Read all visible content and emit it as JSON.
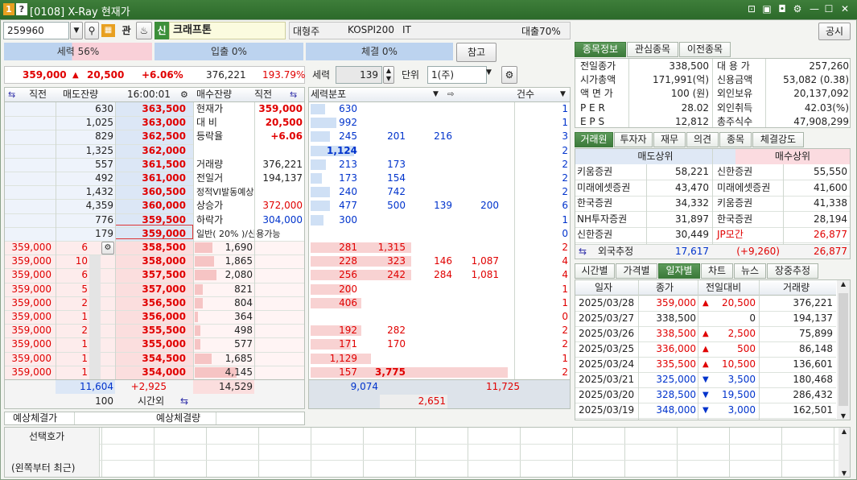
{
  "window": {
    "badge1": "1",
    "badge2": "?",
    "title": "[0108] X-Ray 현재가"
  },
  "colors": {
    "ask_bg": "#eef3fb",
    "bid_bg": "#fdecec",
    "green": "#3b7a39",
    "up": "#e00000",
    "down": "#0033cc"
  },
  "top": {
    "code": "259960",
    "gwan": "관",
    "shin": "신",
    "name": "크래프톤",
    "category": "대형주",
    "index": "KOSPI200",
    "sector": "IT",
    "loan": "대출70%",
    "notice": "공시"
  },
  "strength": {
    "seryuk": "세력 56%",
    "ipchul": "입출 0%",
    "chegyeol": "체결 0%",
    "ref": "참고"
  },
  "price": {
    "cur": "359,000",
    "arrow": "▲",
    "diff": "20,500",
    "rate": "+6.06%",
    "vol": "376,221",
    "pct": "193.79%"
  },
  "ctrl": {
    "seryuk_label": "세력",
    "seryuk_val": "139",
    "unit_label": "단위",
    "unit_val": "1(주)"
  },
  "book_head": {
    "prev": "직전",
    "ask_qty": "매도잔량",
    "time": "16:00:01",
    "bid_qty": "매수잔량",
    "prev2": "직전",
    "dist": "세력분포",
    "count": "건수"
  },
  "asks": [
    {
      "q": "630",
      "p": "363,500",
      "l": "현재가",
      "v": "359,000",
      "d": [
        "630"
      ]
    },
    {
      "q": "1,025",
      "p": "363,000",
      "l": "대  비",
      "v": "20,500",
      "d": [
        "992"
      ]
    },
    {
      "q": "829",
      "p": "362,500",
      "l": "등락율",
      "v": "+6.06",
      "d": [
        "245",
        "201",
        "216"
      ]
    },
    {
      "q": "1,325",
      "p": "362,000",
      "l": "",
      "v": "",
      "d": [
        "1,124"
      ]
    },
    {
      "q": "557",
      "p": "361,500",
      "l": "거래량",
      "v": "376,221",
      "d": [
        "213",
        "173"
      ]
    },
    {
      "q": "492",
      "p": "361,000",
      "l": "전일거",
      "v": "194,137",
      "d": [
        "173",
        "154"
      ]
    },
    {
      "q": "1,432",
      "p": "360,500",
      "l": "정적VI발동예상",
      "v": "",
      "d": [
        "240",
        "742"
      ]
    },
    {
      "q": "4,359",
      "p": "360,000",
      "l": "상승가",
      "v": "372,000",
      "d": [
        "477",
        "500",
        "139",
        "200"
      ]
    },
    {
      "q": "776",
      "p": "359,500",
      "l": "하락가",
      "v": "304,000",
      "d": [
        "300"
      ]
    },
    {
      "q": "179",
      "p": "359,000",
      "l": "일반( 20% )/신용가능",
      "v": "",
      "d": []
    }
  ],
  "ask_counts": [
    "1",
    "1",
    "3",
    "2",
    "2",
    "2",
    "2",
    "6",
    "1",
    "0"
  ],
  "bids": [
    {
      "pp": "359,000",
      "pc": "6",
      "p": "358,500",
      "q": "1,690",
      "d": [
        "281",
        "1,315"
      ]
    },
    {
      "pp": "359,000",
      "pc": "10",
      "p": "358,000",
      "q": "1,865",
      "d": [
        "228",
        "323",
        "146",
        "1,087"
      ]
    },
    {
      "pp": "359,000",
      "pc": "6",
      "p": "357,500",
      "q": "2,080",
      "d": [
        "256",
        "242",
        "284",
        "1,081"
      ]
    },
    {
      "pp": "359,000",
      "pc": "5",
      "p": "357,000",
      "q": "821",
      "d": [
        "200"
      ]
    },
    {
      "pp": "359,000",
      "pc": "2",
      "p": "356,500",
      "q": "804",
      "d": [
        "406"
      ]
    },
    {
      "pp": "359,000",
      "pc": "1",
      "p": "356,000",
      "q": "364",
      "d": []
    },
    {
      "pp": "359,000",
      "pc": "2",
      "p": "355,500",
      "q": "498",
      "d": [
        "192",
        "282"
      ]
    },
    {
      "pp": "359,000",
      "pc": "1",
      "p": "355,000",
      "q": "577",
      "d": [
        "171",
        "170"
      ]
    },
    {
      "pp": "359,000",
      "pc": "1",
      "p": "354,500",
      "q": "1,685",
      "d": [
        "1,129"
      ]
    },
    {
      "pp": "359,000",
      "pc": "1",
      "p": "354,000",
      "q": "4,145",
      "d": [
        "157",
        "3,775"
      ]
    }
  ],
  "bid_counts": [
    "2",
    "4",
    "4",
    "1",
    "1",
    "0",
    "2",
    "2",
    "1",
    "2"
  ],
  "totals": {
    "ask": "11,604",
    "diff": "+2,925",
    "bid": "14,529",
    "after": "100",
    "after_label": "시간외",
    "d1": "9,074",
    "d2": "11,725",
    "d3": "2,651"
  },
  "exp": {
    "p": "예상체결가",
    "q": "예상체결량"
  },
  "info_tabs": [
    "종목정보",
    "관심종목",
    "이전종목"
  ],
  "info": [
    {
      "l1": "전일종가",
      "v1": "338,500",
      "l2": "대 용 가",
      "v2": "257,260"
    },
    {
      "l1": "시가총액",
      "v1": "171,991(억)",
      "l2": "신용금액",
      "v2": "53,082  (0.38)"
    },
    {
      "l1": "액 면 가",
      "v1": "100 (원)",
      "l2": "외인보유",
      "v2": "20,137,092"
    },
    {
      "l1": "P E R",
      "v1": "28.02",
      "l2": "외인취득",
      "v2": "42.03(%)"
    },
    {
      "l1": "E P S",
      "v1": "12,812",
      "l2": "총주식수",
      "v2": "47,908,299"
    }
  ],
  "broker_tabs": [
    "거래원",
    "투자자",
    "재무",
    "의견",
    "종목",
    "체결강도"
  ],
  "broker": {
    "sell_h": "매도상위",
    "buy_h": "매수상위",
    "rows": [
      {
        "s": "키움증권",
        "sv": "58,221",
        "b": "신한증권",
        "bv": "55,550"
      },
      {
        "s": "미래에셋증권",
        "sv": "43,470",
        "b": "미래에셋증권",
        "bv": "41,600"
      },
      {
        "s": "한국증권",
        "sv": "34,332",
        "b": "키움증권",
        "bv": "41,338"
      },
      {
        "s": "NH투자증권",
        "sv": "31,897",
        "b": "한국증권",
        "bv": "28,194"
      },
      {
        "s": "신한증권",
        "sv": "30,449",
        "b": "JP모간",
        "bv": "26,877"
      }
    ],
    "foreign_label": "외국추정",
    "foreign_sell": "17,617",
    "foreign_diff": "(+9,260)",
    "foreign_buy": "26,877"
  },
  "daily_tabs": [
    "시간별",
    "가격별",
    "일자별",
    "차트",
    "뉴스",
    "장중추정"
  ],
  "daily_head": [
    "일자",
    "종가",
    "전일대비",
    "거래량"
  ],
  "daily": [
    {
      "d": "2025/03/28",
      "c": "359,000",
      "a": "▲",
      "ch": "20,500",
      "v": "376,221",
      "dir": "up"
    },
    {
      "d": "2025/03/27",
      "c": "338,500",
      "a": "",
      "ch": "0",
      "v": "194,137",
      "dir": "flat"
    },
    {
      "d": "2025/03/26",
      "c": "338,500",
      "a": "▲",
      "ch": "2,500",
      "v": "75,899",
      "dir": "up"
    },
    {
      "d": "2025/03/25",
      "c": "336,000",
      "a": "▲",
      "ch": "500",
      "v": "86,148",
      "dir": "up"
    },
    {
      "d": "2025/03/24",
      "c": "335,500",
      "a": "▲",
      "ch": "10,500",
      "v": "136,601",
      "dir": "up"
    },
    {
      "d": "2025/03/21",
      "c": "325,000",
      "a": "▼",
      "ch": "3,500",
      "v": "180,468",
      "dir": "down"
    },
    {
      "d": "2025/03/20",
      "c": "328,500",
      "a": "▼",
      "ch": "19,500",
      "v": "286,432",
      "dir": "down"
    },
    {
      "d": "2025/03/19",
      "c": "348,000",
      "a": "▼",
      "ch": "3,000",
      "v": "162,501",
      "dir": "down"
    }
  ],
  "bottom": {
    "l1": "선택호가",
    "l2": "(왼쪽부터 최근)"
  }
}
